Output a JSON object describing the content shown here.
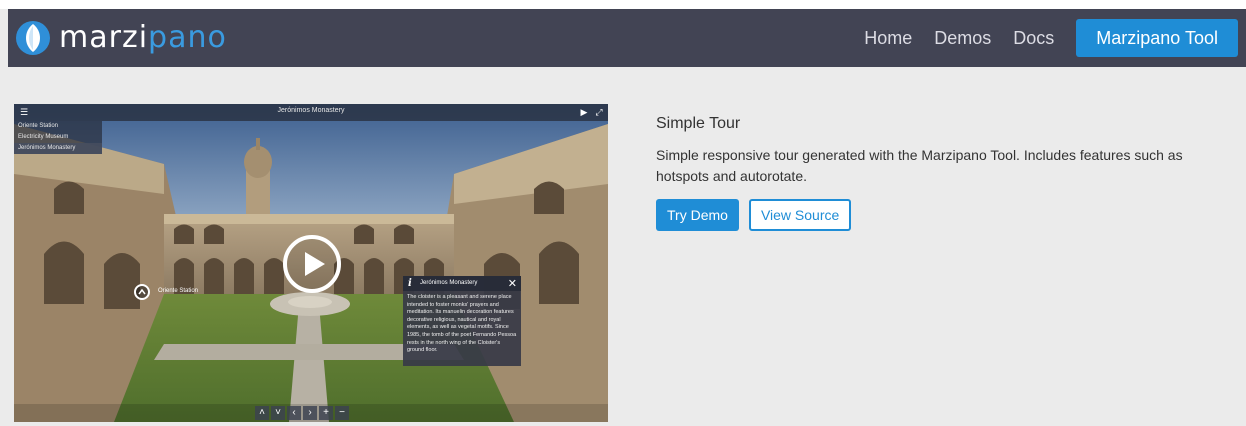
{
  "brand": {
    "name_part1": "marzi",
    "name_part2": "pano"
  },
  "nav": {
    "home": "Home",
    "demos": "Demos",
    "docs": "Docs",
    "tool": "Marzipano Tool"
  },
  "viewer": {
    "title": "Jerónimos Monastery",
    "scenes": [
      "Oriente Station",
      "Electricity Museum",
      "Jerónimos Monastery"
    ],
    "active_scene": "Jerónimos Monastery",
    "link_hotspot_label": "Oriente Station",
    "info_hotspot": {
      "title": "Jerónimos Monastery",
      "text": "The cloister is a pleasant and serene place intended to foster monks' prayers and meditation. Its manuelin decoration features decorative religious, nautical and royal elements, as well as vegetal motifs. Since 1985, the tomb of the poet Fernando Pessoa rests in the north wing of the Cloister's ground floor."
    }
  },
  "demo": {
    "title": "Simple Tour",
    "description": "Simple responsive tour generated with the Marzipano Tool. Includes features such as hotspots and autorotate.",
    "try_label": "Try Demo",
    "source_label": "View Source"
  },
  "colors": {
    "header_bg": "#424454",
    "accent": "#1f8dd6",
    "page_bg": "#ebebeb"
  }
}
